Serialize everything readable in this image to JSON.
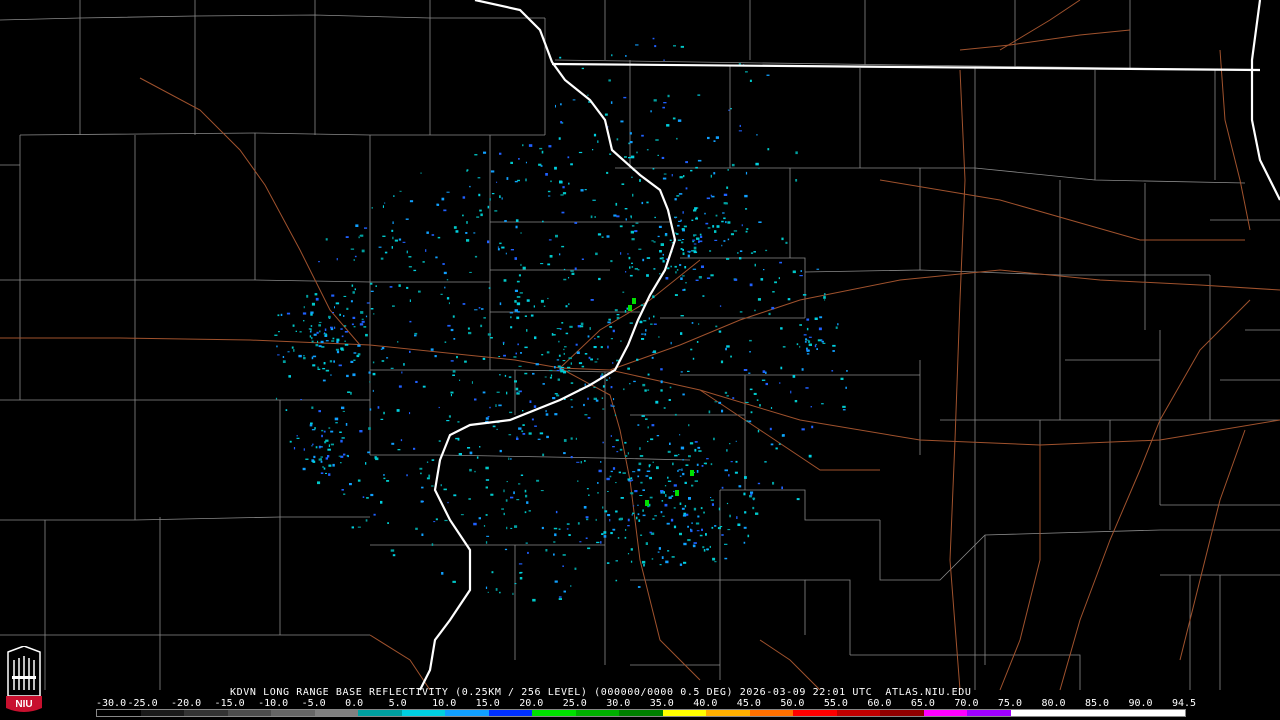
{
  "header": {
    "product_line": "KDVN LONG RANGE BASE REFLECTIVITY (0.25KM / 256 LEVEL) (000000/0000 0.5 DEG) 2026-03-09 22:01 UTC  ATLAS.NIU.EDU"
  },
  "logo": {
    "text": "NIU",
    "icon": "university-seal-icon",
    "brand_color": "#c8102e"
  },
  "map": {
    "radar_site": "KDVN",
    "background_color": "#000000",
    "state_border_color": "#ffffff",
    "county_border_color": "#8a8a8a",
    "highway_color": "#a0522d"
  },
  "scale": {
    "labels": [
      "-30.0",
      "-25.0",
      "-20.0",
      "-15.0",
      "-10.0",
      "-5.0",
      "0.0",
      "5.0",
      "10.0",
      "15.0",
      "20.0",
      "25.0",
      "30.0",
      "35.0",
      "40.0",
      "45.0",
      "50.0",
      "55.0",
      "60.0",
      "65.0",
      "70.0",
      "75.0",
      "80.0",
      "85.0",
      "90.0",
      "94.5"
    ],
    "colors": [
      "#000000",
      "#1a1a1a",
      "#333333",
      "#4d4d4d",
      "#666666",
      "#808080",
      "#00a0a0",
      "#00d0e0",
      "#10a0ff",
      "#0030ff",
      "#00e000",
      "#00b000",
      "#008000",
      "#ffff00",
      "#ffb000",
      "#ff7000",
      "#ff0000",
      "#c00000",
      "#900000",
      "#ff00ff",
      "#a000ff",
      "#ffffff",
      "#ffffff",
      "#ffffff",
      "#ffffff"
    ]
  }
}
